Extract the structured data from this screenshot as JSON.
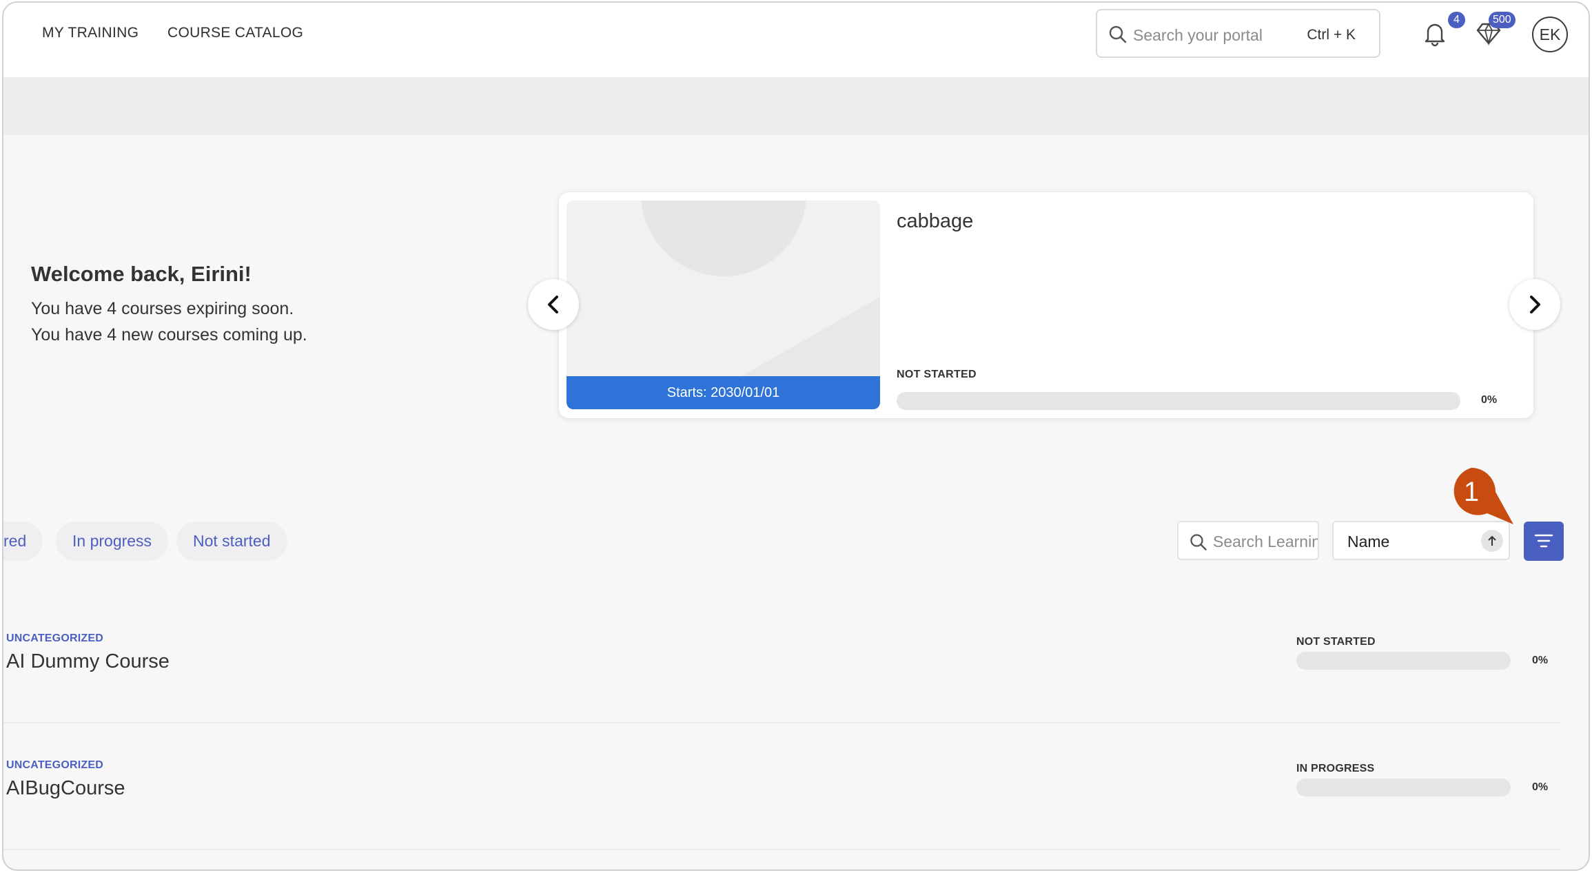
{
  "nav": {
    "my_training": "MY TRAINING",
    "course_catalog": "COURSE CATALOG"
  },
  "search": {
    "placeholder": "Search your portal",
    "shortcut": "Ctrl + K"
  },
  "header": {
    "notifications_count": "4",
    "points_count": "500",
    "avatar_initials": "EK",
    "icons": [
      "bell-icon",
      "gem-icon",
      "search-icon"
    ]
  },
  "welcome": {
    "title": "Welcome back, Eirini!",
    "expiring": "You have 4 courses expiring soon.",
    "upcoming": "You have 4 new courses coming up."
  },
  "carousel": {
    "card": {
      "title": "cabbage",
      "starts": "Starts: 2030/01/01",
      "status": "NOT STARTED",
      "progress_percent": 0,
      "progress_label": "0%"
    }
  },
  "filters": {
    "chips": [
      {
        "label": "red"
      },
      {
        "label": "In progress"
      },
      {
        "label": "Not started"
      }
    ],
    "search_placeholder": "Search Learning",
    "sort_value": "Name",
    "sort_direction": "ascending"
  },
  "callout": {
    "number": "1",
    "color": "#c84b0f"
  },
  "courses": [
    {
      "category": "UNCATEGORIZED",
      "name": "AI Dummy Course",
      "status": "NOT STARTED",
      "progress_percent": 0,
      "progress_label": "0%"
    },
    {
      "category": "UNCATEGORIZED",
      "name": "AIBugCourse",
      "status": "IN PROGRESS",
      "progress_percent": 0,
      "progress_label": "0%"
    }
  ],
  "colors": {
    "accent": "#4b5fc0",
    "date_banner": "#2f73d8",
    "callout": "#c84b0f"
  }
}
